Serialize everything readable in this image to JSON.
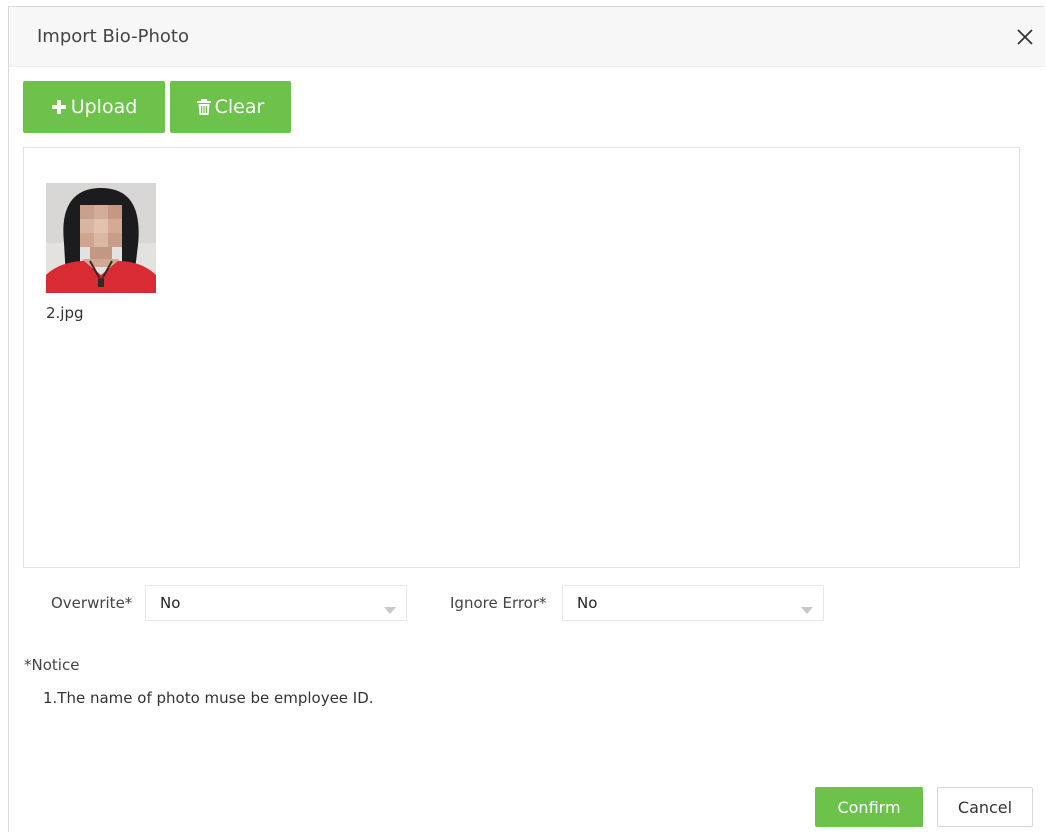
{
  "dialog": {
    "title": "Import Bio-Photo",
    "close_icon": "close-icon"
  },
  "toolbar": {
    "upload_label": "Upload",
    "upload_icon": "plus-icon",
    "clear_label": "Clear",
    "clear_icon": "trash-icon"
  },
  "photos": [
    {
      "file_name": "2.jpg"
    }
  ],
  "options": {
    "overwrite": {
      "label": "Overwrite*",
      "value": "No"
    },
    "ignore_error": {
      "label": "Ignore Error*",
      "value": "No"
    }
  },
  "notice": {
    "title": "*Notice",
    "lines": [
      "1.The name of photo muse be employee ID."
    ]
  },
  "footer": {
    "confirm_label": "Confirm",
    "cancel_label": "Cancel"
  },
  "colors": {
    "accent_green": "#6cc24a",
    "header_bg": "#f7f7f7"
  }
}
